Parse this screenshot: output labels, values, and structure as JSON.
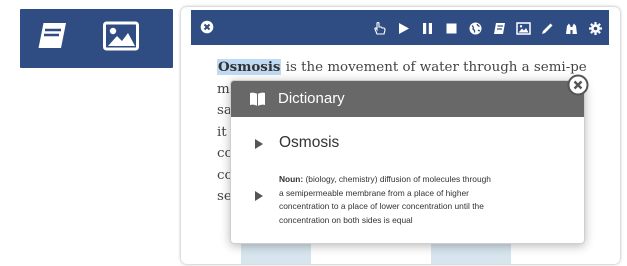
{
  "left_toolbar": {
    "icons": [
      "book-icon",
      "image-icon"
    ],
    "background": "#2f4d82"
  },
  "reader_toolbar": {
    "background": "#2f4d82",
    "icons": [
      "close-icon",
      "hand-pointer-icon",
      "play-icon",
      "pause-icon",
      "stop-icon",
      "globe-icon",
      "dictionary-icon",
      "picture-icon",
      "pencil-icon",
      "binoculars-icon",
      "gear-icon"
    ]
  },
  "passage": {
    "highlighted_word": "Osmosis",
    "line1_rest": " is the movement of water through a semi-permeable",
    "partial_lines": [
      "m",
      "sa",
      "it",
      "co",
      "co",
      "se"
    ]
  },
  "dictionary": {
    "title": "Dictionary",
    "word": "Osmosis",
    "part_of_speech": "Noun:",
    "definition_lines": [
      " (biology, chemistry) diffusion of molecules through",
      "a semipermeable membrane from a place of higher",
      "concentration to a place of lower concentration until the",
      "concentration on both sides is equal"
    ],
    "header_color": "#686868"
  }
}
